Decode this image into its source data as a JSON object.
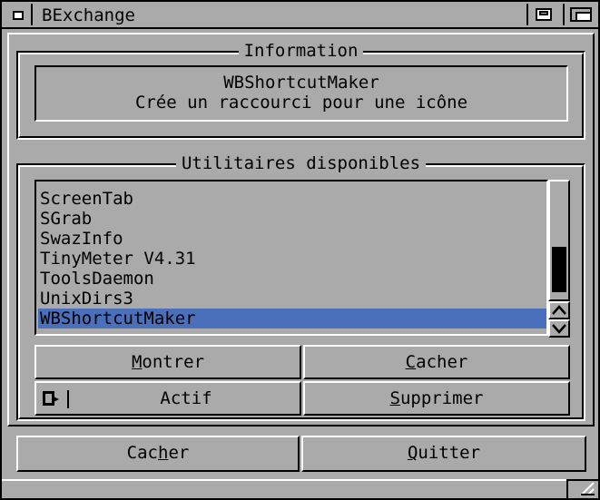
{
  "window": {
    "title": "BExchange"
  },
  "information": {
    "group_title": "Information",
    "name": "WBShortcutMaker",
    "description": "Crée un raccourci pour une icône"
  },
  "utilities": {
    "group_title": "Utilitaires disponibles",
    "items": [
      {
        "label": "ScreenTab",
        "selected": false
      },
      {
        "label": "SGrab",
        "selected": false
      },
      {
        "label": "SwazInfo",
        "selected": false
      },
      {
        "label": "TinyMeter V4.31",
        "selected": false
      },
      {
        "label": "ToolsDaemon",
        "selected": false
      },
      {
        "label": "UnixDirs3",
        "selected": false
      },
      {
        "label": "WBShortcutMaker",
        "selected": true
      }
    ],
    "scroll_position": 0.72
  },
  "buttons": {
    "montrer": {
      "underline": "M",
      "rest": "ontrer"
    },
    "cacher": {
      "underline": "C",
      "rest": "acher"
    },
    "actif": "Actif",
    "supprimer": {
      "underline": "S",
      "rest": "upprimer"
    },
    "cacher_bottom": {
      "before": "Cac",
      "underline": "h",
      "after": "er"
    },
    "quitter": {
      "underline": "Q",
      "rest": "uitter"
    }
  },
  "colors": {
    "selection": "#4a6fbb",
    "background": "#aaaaaa"
  },
  "icons": {
    "cycle": "cycle-icon",
    "scroll_up": "chevron-up-icon",
    "scroll_down": "chevron-down-icon"
  }
}
